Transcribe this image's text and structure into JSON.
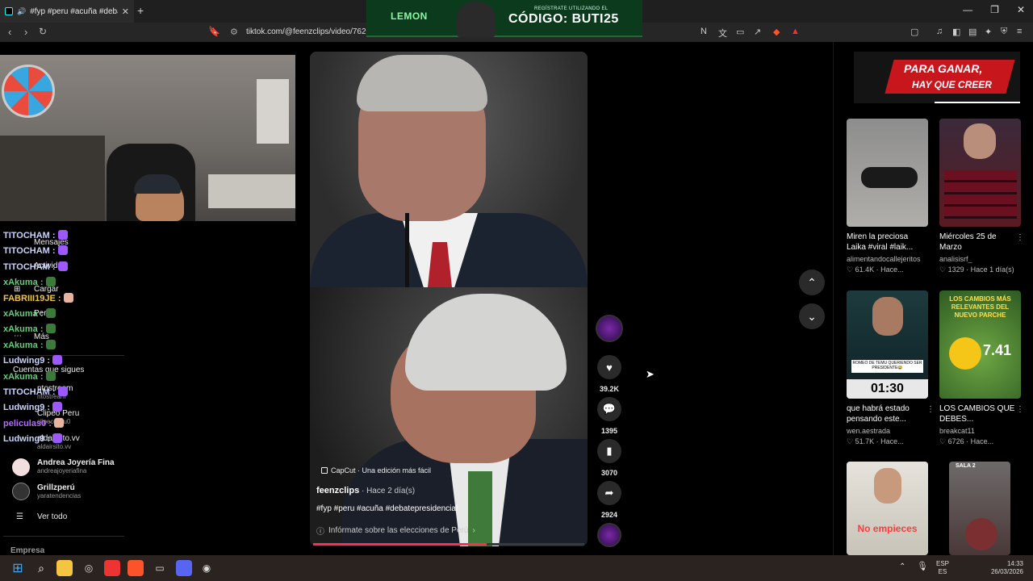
{
  "browser": {
    "tab_title": "#fyp #peru #acuña #debatep",
    "tab_close": "✕",
    "new_tab": "+",
    "url": "tiktok.com/@feenzclips/video/7620",
    "window_controls": [
      "—",
      "❐",
      "✕"
    ]
  },
  "top_ad": {
    "logo": "LEMON",
    "register": "REGÍSTRATE UTILIZANDO EL",
    "code": "CÓDIGO: BUTI25"
  },
  "chat": {
    "messages": [
      {
        "user": "TITOCHAM :",
        "color": "#c9d4ff",
        "emote": "#9b59ff"
      },
      {
        "user": "TITOCHAM :",
        "color": "#c9d4ff",
        "emote": "#9b59ff"
      },
      {
        "user": "TITOCHAM :",
        "color": "#c9d4ff",
        "emote": "#9b59ff"
      },
      {
        "user": "xAkuma :",
        "color": "#5fd07a",
        "emote": "#3c7a3c"
      },
      {
        "user": "FABRIII19JE :",
        "color": "#f4c542",
        "emote": "#e8b4a0"
      },
      {
        "user": "xAkuma :",
        "color": "#5fd07a",
        "emote": "#3c7a3c"
      },
      {
        "user": "xAkuma :",
        "color": "#5fd07a",
        "emote": "#3c7a3c"
      },
      {
        "user": "xAkuma :",
        "color": "#5fd07a",
        "emote": "#3c7a3c"
      },
      {
        "user": "Ludwing9 :",
        "color": "#c9d4ff",
        "emote": "#9b59ff"
      },
      {
        "user": "xAkuma :",
        "color": "#5fd07a",
        "emote": "#3c7a3c"
      },
      {
        "user": "TITOCHAM :",
        "color": "#c9d4ff",
        "emote": "#9b59ff"
      },
      {
        "user": "Ludwing9 :",
        "color": "#c9d4ff",
        "emote": "#9b59ff"
      },
      {
        "user": "peliculas0 :",
        "color": "#b46bff",
        "emote": "#e8b4a0"
      },
      {
        "user": "Ludwing9 :",
        "color": "#c9d4ff",
        "emote": "#9b59ff"
      }
    ]
  },
  "sidebar": {
    "mensajes": "Mensajes",
    "actividad": "Actividad",
    "cargar": "Cargar",
    "perfil": "Perfil",
    "mas": "Más",
    "cuentas_que_sigues": "Cuentas que sigues",
    "accounts": [
      {
        "name": "ntostream",
        "handle": "ntostream"
      },
      {
        "name": "Clipeo Peru",
        "handle": "clipeoperu0"
      },
      {
        "name": "aldairsito.vv",
        "handle": "aldairsito.vv"
      },
      {
        "name": "Andrea Joyería Fina",
        "handle": "andreajoyeriafina"
      },
      {
        "name": "Grillzperú",
        "handle": "yaratendencias"
      }
    ],
    "ver_todo": "Ver todo",
    "empresa": "Empresa"
  },
  "video": {
    "capcut": "CapCut · Una edición más fácil",
    "author": "feenzclips",
    "time": " · Hace 2 día(s)",
    "hashtags": "#fyp #peru #acuña #debatepresidencial",
    "info": "Infórmate sobre las elecciones de Perú",
    "progress": 0.64
  },
  "actions": {
    "likes": "39.2K",
    "comments": "1395",
    "saves": "3070",
    "shares": "2924"
  },
  "right_ad": {
    "line1": "PARA GANAR,",
    "line2": "HAY QUE CREER"
  },
  "cards": [
    {
      "title": "Miren la preciosa Laika #viral #laik...",
      "author": "alimentandocallejeritos",
      "likes": "61.4K",
      "time": "Hace..."
    },
    {
      "title": "Miércoles 25 de Marzo",
      "author": "analisisrf_",
      "likes": "1329",
      "time": "Hace 1 día(s)"
    },
    {
      "title": "que habrá estado pensando este...",
      "author": "wen.aestrada",
      "likes": "51.7K",
      "time": "Hace...",
      "overlay_top": "ROMEO DE TEMU QUERIENDO SER PRESIDENTE😂",
      "overlay_time": "01:30"
    },
    {
      "title": "LOS CAMBIOS QUE DEBES...",
      "author": "breakcat11",
      "likes": "6726",
      "time": "Hace...",
      "overlay_top": "LOS CAMBIOS MÁS RELEVANTES DEL NUEVO PARCHE",
      "overlay_num": "7.41"
    },
    {
      "title": "",
      "author": "",
      "likes": "",
      "time": "",
      "overlay_top": "No empieces"
    },
    {
      "title": "",
      "author": "",
      "likes": "",
      "time": "",
      "overlay_top": "SALA 2"
    }
  ],
  "taskbar": {
    "lang": "ESP",
    "lang2": "ES",
    "time": "14:33",
    "date": "26/03/2026"
  },
  "colors": {
    "tiktok_red": "#fe2c55",
    "lemon_green": "#8cf5a5"
  }
}
